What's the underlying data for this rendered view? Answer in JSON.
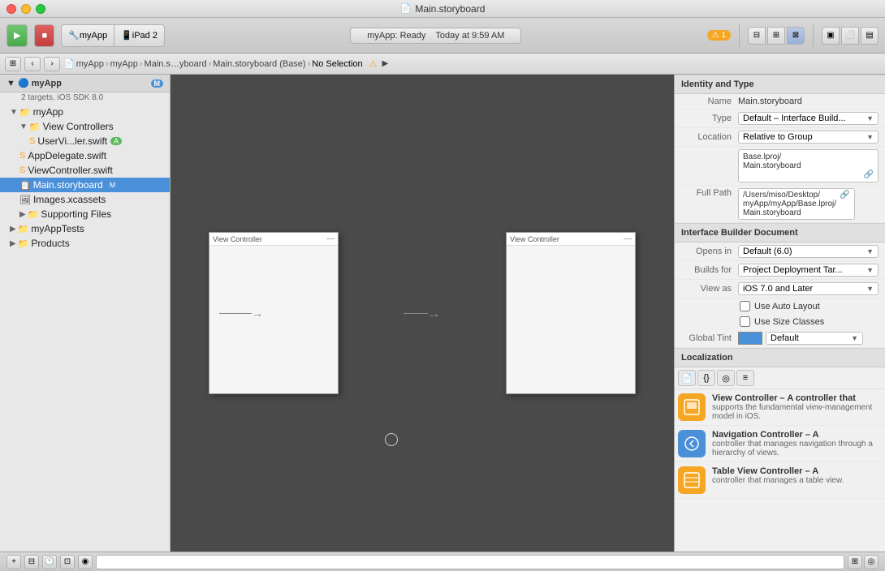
{
  "window": {
    "title": "Main.storyboard",
    "title_icon": "📄"
  },
  "toolbar": {
    "run_label": "▶",
    "stop_label": "■",
    "scheme_app": "myApp",
    "scheme_device": "iPad 2",
    "status_app": "myApp: Ready",
    "status_time": "Today at 9:59 AM",
    "warning_count": "1"
  },
  "navbar": {
    "back_label": "‹",
    "forward_label": "›",
    "breadcrumbs": [
      "myApp",
      "myApp",
      "Main.s…yboard",
      "Main.storyboard (Base)",
      "No Selection"
    ]
  },
  "sidebar": {
    "project_name": "myApp",
    "project_subtitle": "2 targets, iOS SDK 8.0",
    "project_badge": "M",
    "items": [
      {
        "label": "myApp",
        "level": 1,
        "type": "folder",
        "expanded": true
      },
      {
        "label": "View Controllers",
        "level": 2,
        "type": "folder",
        "expanded": true
      },
      {
        "label": "UserVi...ler.swift",
        "level": 3,
        "type": "swift",
        "badge": "A"
      },
      {
        "label": "AppDelegate.swift",
        "level": 2,
        "type": "swift"
      },
      {
        "label": "ViewController.swift",
        "level": 2,
        "type": "swift"
      },
      {
        "label": "Main.storyboard",
        "level": 2,
        "type": "storyboard",
        "badge": "M",
        "selected": true
      },
      {
        "label": "Images.xcassets",
        "level": 2,
        "type": "assets"
      },
      {
        "label": "Supporting Files",
        "level": 2,
        "type": "folder"
      },
      {
        "label": "myAppTests",
        "level": 1,
        "type": "folder"
      },
      {
        "label": "Products",
        "level": 1,
        "type": "folder"
      }
    ]
  },
  "canvas": {
    "scene1_title": "View Controller",
    "scene2_title": "View Controller"
  },
  "right_panel": {
    "identity_type_header": "Identity and Type",
    "name_label": "Name",
    "name_value": "Main.storyboard",
    "type_label": "Type",
    "type_value": "Default – Interface Build...",
    "location_label": "Location",
    "location_value": "Relative to Group",
    "base_path": "Base.lproj/\nMain.storyboard",
    "full_path_label": "Full Path",
    "full_path_value": "/Users/miso/Desktop/\nmyApp/myApp/Base.lproj/\nMain.storyboard",
    "ib_document_header": "Interface Builder Document",
    "opens_in_label": "Opens in",
    "opens_in_value": "Default (6.0)",
    "builds_for_label": "Builds for",
    "builds_for_value": "Project Deployment Tar...",
    "view_as_label": "View as",
    "view_as_value": "iOS 7.0 and Later",
    "auto_layout_label": "Use Auto Layout",
    "size_classes_label": "Use Size Classes",
    "global_tint_label": "Global Tint",
    "global_tint_text": "Default",
    "localization_header": "Localization",
    "lib_items": [
      {
        "name": "View Controller",
        "desc": "A controller that supports the fundamental view-management model in iOS.",
        "icon": "□",
        "color": "orange"
      },
      {
        "name": "Navigation Controller",
        "desc": "A controller that manages navigation through a hierarchy of views.",
        "icon": "‹",
        "color": "blue"
      },
      {
        "name": "Table View Controller",
        "desc": "A controller that manages a table view.",
        "icon": "≡",
        "color": "orange"
      }
    ]
  }
}
